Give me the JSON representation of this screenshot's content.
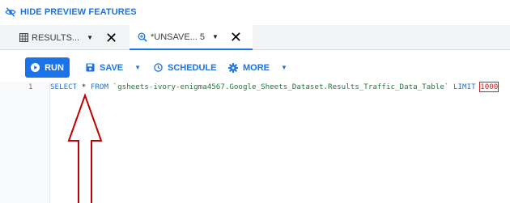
{
  "top_link": {
    "label": "HIDE PREVIEW FEATURES",
    "icon": "eye-off-icon"
  },
  "tabs": [
    {
      "label": "RESULTS...",
      "icon": "table-grid-icon"
    },
    {
      "label": "*UNSAVE...",
      "count": "5",
      "icon": "query-search-icon"
    }
  ],
  "toolbar": {
    "run": "RUN",
    "save": "SAVE",
    "schedule": "SCHEDULE",
    "more": "MORE"
  },
  "editor": {
    "line_number": "1",
    "tokens": {
      "select": "SELECT",
      "star": "*",
      "from": "FROM",
      "table": "`gsheets-ivory-enigma4567.Google_Sheets_Dataset.Results_Traffic_Data_Table`",
      "limit": "LIMIT",
      "limit_value": "1000"
    }
  },
  "colors": {
    "accent": "#1a73e8",
    "annotation_arrow": "#c00000",
    "string": "#188038",
    "number": "#c5221f"
  }
}
